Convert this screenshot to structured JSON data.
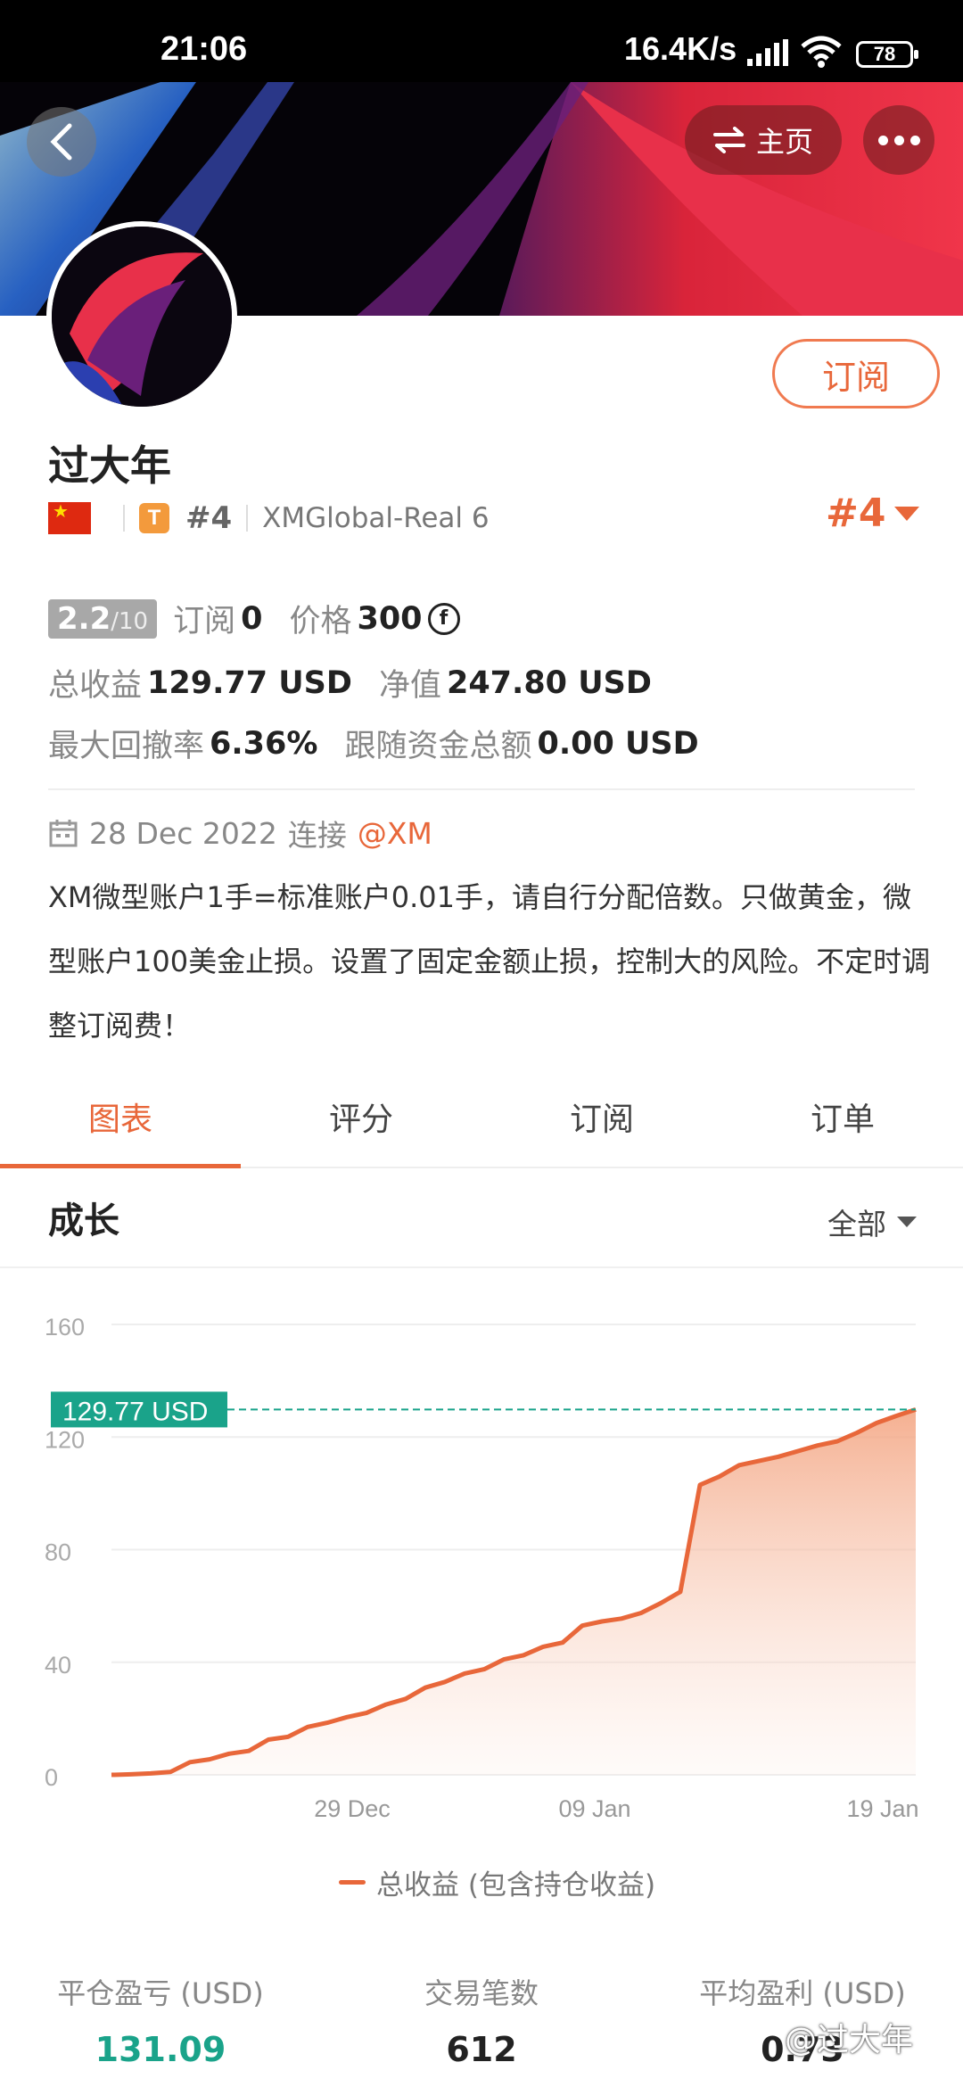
{
  "status_bar": {
    "time": "21:06",
    "network_speed": "16.4K/s",
    "battery": "78"
  },
  "header": {
    "home_label": "主页"
  },
  "profile": {
    "subscribe_label": "订阅",
    "name": "过大年",
    "badge_letter": "T",
    "rank_short": "#4",
    "broker": "XMGlobal-Real 6",
    "rank_big": "#4"
  },
  "stats_rows": {
    "score": "2.2",
    "score_max": "/10",
    "subs_label": "订阅",
    "subs_value": "0",
    "price_label": "价格",
    "price_value": "300",
    "total_profit_label": "总收益",
    "total_profit_value": "129.77 USD",
    "equity_label": "净值",
    "equity_value": "247.80 USD",
    "max_dd_label": "最大回撤率",
    "max_dd_value": "6.36%",
    "follow_funds_label": "跟随资金总额",
    "follow_funds_value": "0.00 USD"
  },
  "connection": {
    "date": "28 Dec 2022",
    "connect_label": "连接",
    "platform": "@XM"
  },
  "description": "XM微型账户1手=标准账户0.01手，请自行分配倍数。只做黄金，微型账户100美金止损。设置了固定金额止损，控制大的风险。不定时调整订阅费！",
  "tabs": [
    {
      "label": "图表",
      "active": true
    },
    {
      "label": "评分",
      "active": false
    },
    {
      "label": "订阅",
      "active": false
    },
    {
      "label": "订单",
      "active": false
    }
  ],
  "growth": {
    "title": "成长",
    "range_label": "全部"
  },
  "chart_data": {
    "type": "area",
    "current_label": "129.77 USD",
    "ylim": [
      0,
      160
    ],
    "y_ticks": [
      0,
      40,
      80,
      120,
      160
    ],
    "x_ticks": [
      "29 Dec",
      "09 Jan",
      "19 Jan"
    ],
    "legend": "总收益 (包含持仓收益)",
    "line_color": "#e8673a",
    "series": [
      {
        "name": "总收益 (包含持仓收益)",
        "values": [
          0,
          0.2,
          0.5,
          1,
          4.5,
          5.5,
          7.5,
          8.5,
          12.5,
          13.5,
          17,
          18.5,
          20.5,
          22,
          25,
          27,
          31,
          33,
          36,
          37.5,
          41,
          42.5,
          45.5,
          47,
          53,
          54.5,
          55.5,
          57.5,
          61,
          65,
          103,
          106,
          110,
          111.5,
          113,
          115,
          117,
          118.5,
          121.5,
          125,
          127.5,
          129.77
        ]
      }
    ]
  },
  "summary": [
    {
      "label": "平仓盈亏 (USD)",
      "value": "131.09",
      "color": "#1aa38a"
    },
    {
      "label": "交易笔数",
      "value": "612",
      "color": "#222222"
    },
    {
      "label": "平均盈利 (USD)",
      "value": "0.73",
      "color": "#222222"
    }
  ],
  "watermark": "@过大年"
}
